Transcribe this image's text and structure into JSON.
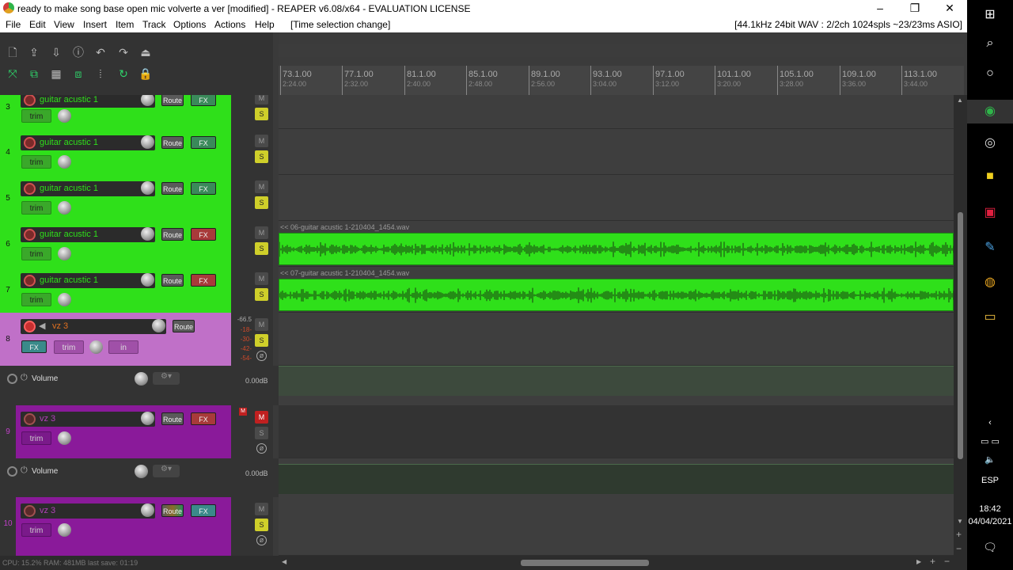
{
  "window": {
    "title": "ready to make song  base open mic volverte a ver [modified] - REAPER v6.08/x64 - EVALUATION LICENSE",
    "minimize": "–",
    "restore": "❐",
    "close": "✕"
  },
  "menu": {
    "items": [
      "File",
      "Edit",
      "View",
      "Insert",
      "Item",
      "Track",
      "Options",
      "Actions",
      "Help"
    ],
    "action_status": "[Time selection change]",
    "audio_status": "[44.1kHz 24bit WAV : 2/2ch 1024spls ~23/23ms ASIO]"
  },
  "ruler": {
    "marks": [
      {
        "bar": "73.1.00",
        "time": "2:24.00"
      },
      {
        "bar": "77.1.00",
        "time": "2:32.00"
      },
      {
        "bar": "81.1.00",
        "time": "2:40.00"
      },
      {
        "bar": "85.1.00",
        "time": "2:48.00"
      },
      {
        "bar": "89.1.00",
        "time": "2:56.00"
      },
      {
        "bar": "93.1.00",
        "time": "3:04.00"
      },
      {
        "bar": "97.1.00",
        "time": "3:12.00"
      },
      {
        "bar": "101.1.00",
        "time": "3:20.00"
      },
      {
        "bar": "105.1.00",
        "time": "3:28.00"
      },
      {
        "bar": "109.1.00",
        "time": "3:36.00"
      },
      {
        "bar": "113.1.00",
        "time": "3:44.00"
      }
    ]
  },
  "tracks": [
    {
      "num": "3",
      "name": "guitar acustic 1",
      "route": "Route",
      "fx": "FX",
      "trim": "trim",
      "mute": "M",
      "solo": "S"
    },
    {
      "num": "4",
      "name": "guitar acustic 1",
      "route": "Route",
      "fx": "FX",
      "trim": "trim",
      "mute": "M",
      "solo": "S"
    },
    {
      "num": "5",
      "name": "guitar acustic 1",
      "route": "Route",
      "fx": "FX",
      "trim": "trim",
      "mute": "M",
      "solo": "S"
    },
    {
      "num": "6",
      "name": "guitar acustic 1",
      "route": "Route",
      "fx": "FX",
      "trim": "trim",
      "mute": "M",
      "solo": "S",
      "item": "<< 06-guitar acustic 1-210404_1454.wav"
    },
    {
      "num": "7",
      "name": "guitar acustic 1",
      "route": "Route",
      "fx": "FX",
      "trim": "trim",
      "mute": "M",
      "solo": "S",
      "item": "<< 07-guitar acustic 1-210404_1454.wav"
    },
    {
      "num": "8",
      "name": "vz 3",
      "route": "Route",
      "fx": "FX",
      "trim": "trim",
      "in": "in",
      "mute": "M",
      "solo": "S",
      "meter": [
        "-66.5",
        "-18-",
        "-30-",
        "-42-",
        "-54-"
      ]
    },
    {
      "num": "9",
      "name": "vz 3",
      "route": "Route",
      "fx": "FX",
      "trim": "trim",
      "mute": "M",
      "solo": "S"
    },
    {
      "num": "10",
      "name": "vz 3",
      "route": "Route",
      "fx": "FX",
      "trim": "trim",
      "mute": "M",
      "solo": "S"
    }
  ],
  "envelopes": [
    {
      "label": "Volume",
      "value": "0.00dB"
    },
    {
      "label": "Volume",
      "value": "0.00dB"
    }
  ],
  "statusbar": "CPU: 15.2% RAM: 481MB last save: 01:19",
  "taskbar": {
    "lang": "ESP",
    "time": "18:42",
    "date": "04/04/2021"
  },
  "colors": {
    "green_track": "#2fe01a",
    "pink_track": "#c070c8",
    "purple_track": "#8a1a9a"
  }
}
